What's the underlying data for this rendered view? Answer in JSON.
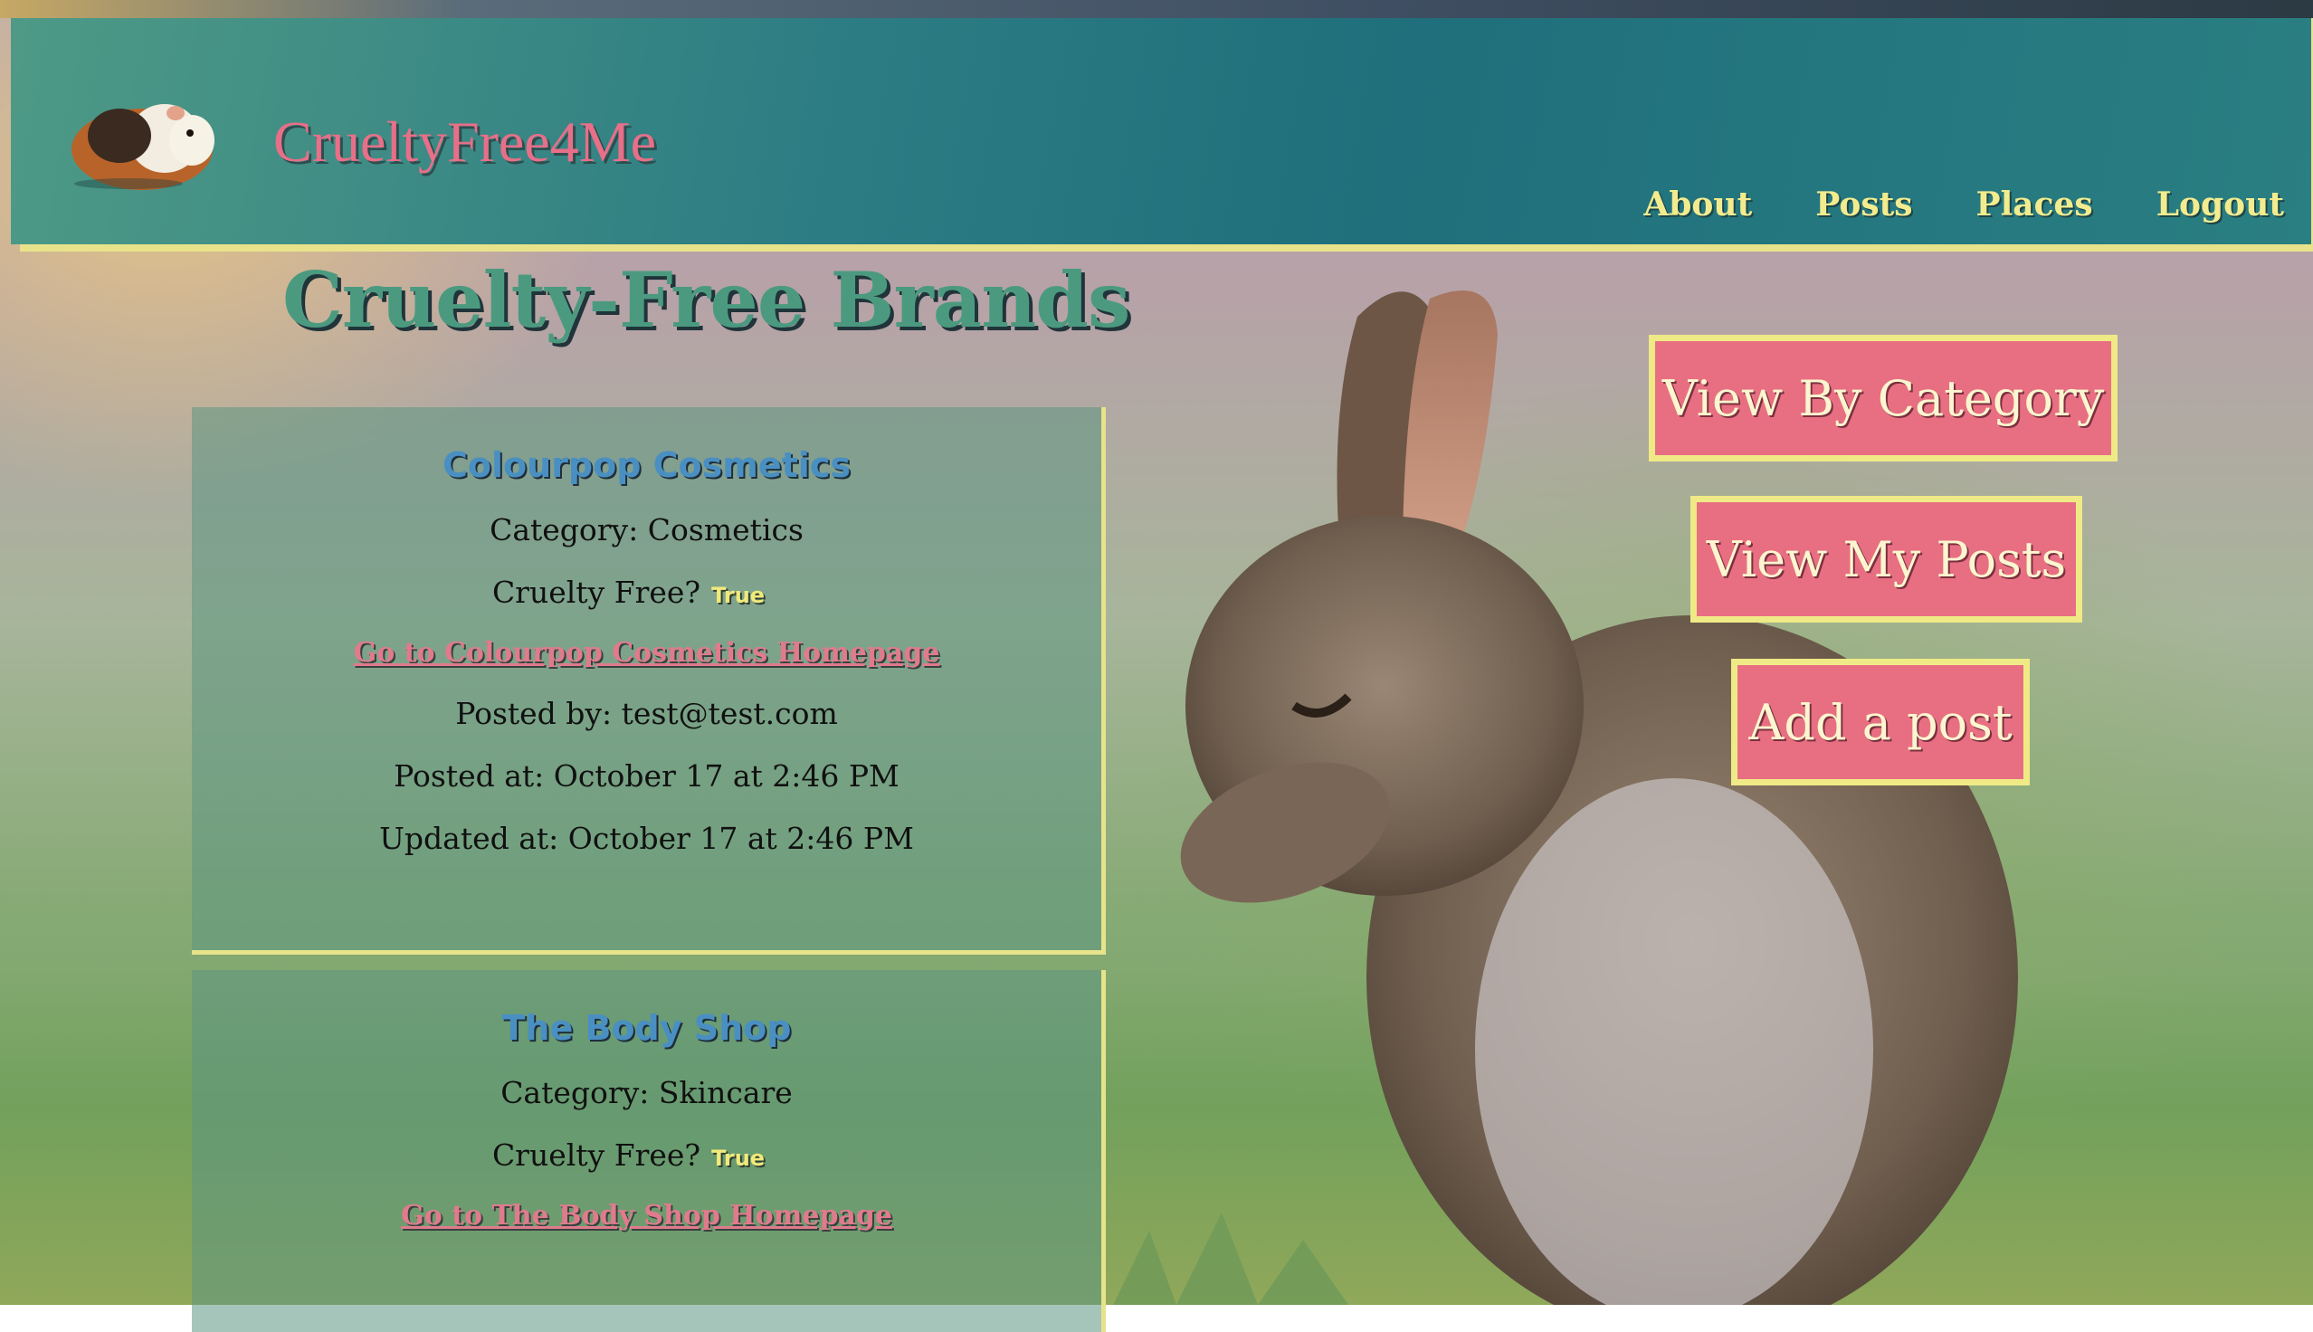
{
  "header": {
    "brand": "CrueltyFree4Me",
    "nav": [
      "About",
      "Posts",
      "Places",
      "Logout"
    ]
  },
  "page": {
    "title": "Cruelty-Free Brands"
  },
  "actions": {
    "view_by_category": "View By Category",
    "view_my_posts": "View My Posts",
    "add_post": "Add a post"
  },
  "posts": [
    {
      "name": "Colourpop Cosmetics",
      "category": "Category: Cosmetics",
      "cruelty_free_label": "Cruelty Free?",
      "cruelty_free_value": "True",
      "homepage_link": "Go to Colourpop Cosmetics Homepage",
      "posted_by": "Posted by: test@test.com",
      "posted_at": "Posted at: October 17 at 2:46 PM",
      "updated_at": "Updated at: October 17 at 2:46 PM"
    },
    {
      "name": "The Body Shop",
      "category": "Category: Skincare",
      "cruelty_free_label": "Cruelty Free?",
      "cruelty_free_value": "True",
      "homepage_link": "Go to The Body Shop Homepage"
    }
  ],
  "colors": {
    "header": "#2d7d84",
    "accent_yellow": "#f0ea86",
    "button_pink": "#e86f82",
    "brand_pink": "#e86f88",
    "title_green": "#4b9a80"
  },
  "icons": [
    "guinea-pig-logo",
    "bunny-photo"
  ]
}
